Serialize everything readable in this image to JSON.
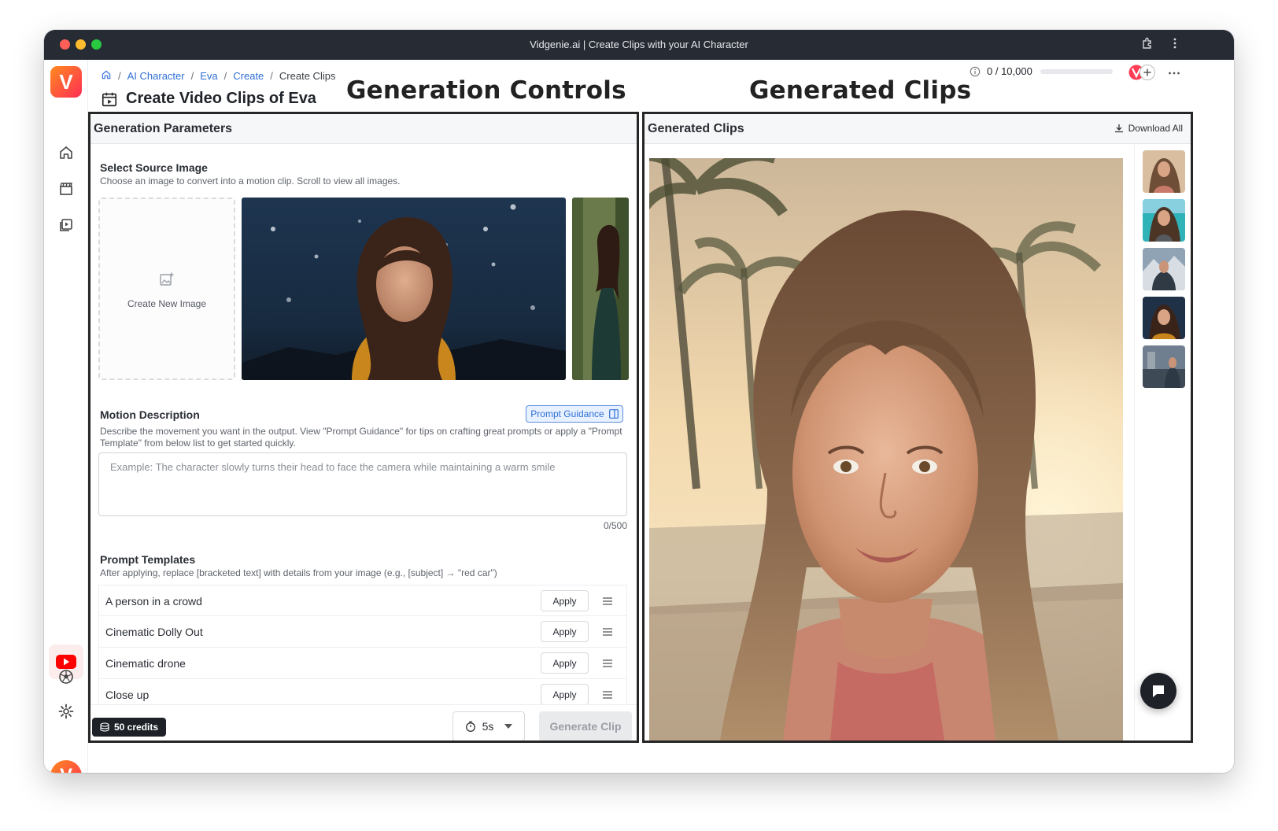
{
  "window": {
    "title": "Vidgenie.ai | Create Clips with your AI Character"
  },
  "sidebar": {
    "logo_letter": "V",
    "avatar_letter": "V",
    "icons": [
      "home-icon",
      "clapperboard-icon",
      "video-library-icon",
      "youtube-icon",
      "soccer-ball-icon",
      "gear-icon"
    ]
  },
  "breadcrumb": {
    "items": [
      "AI Character",
      "Eva",
      "Create"
    ],
    "current": "Create Clips"
  },
  "header": {
    "page_title": "Create Video Clips of Eva",
    "credits_usage": "0 / 10,000"
  },
  "annotations": {
    "left": "Generation Controls",
    "right": "Generated Clips"
  },
  "params_panel": {
    "title": "Generation Parameters",
    "source": {
      "title": "Select Source Image",
      "hint": "Choose an image to convert into a motion clip. Scroll to view all images.",
      "new_image_label": "Create New Image"
    },
    "motion": {
      "title": "Motion Description",
      "guidance_label": "Prompt Guidance",
      "hint": "Describe the movement you want in the output. View \"Prompt Guidance\" for tips on crafting great prompts or apply a \"Prompt Template\" from below list to get started quickly.",
      "placeholder": "Example: The character slowly turns their head to face the camera while maintaining a warm smile",
      "value": "",
      "counter": "0/500"
    },
    "templates": {
      "title": "Prompt Templates",
      "hint": "After applying, replace [bracketed text] with details from your image (e.g., [subject] → \"red car\")",
      "apply_label": "Apply",
      "items": [
        "A person in a crowd",
        "Cinematic Dolly Out",
        "Cinematic drone",
        "Close up"
      ]
    },
    "footer": {
      "credits_label": "50 credits",
      "duration": "5s",
      "generate_label": "Generate Clip"
    }
  },
  "clips_panel": {
    "title": "Generated Clips",
    "download_all": "Download All",
    "thumb_count": 5
  },
  "colors": {
    "accent": "#2f6fd6",
    "brand_gradient_start": "#ff8a1f",
    "brand_gradient_end": "#ff2d55",
    "panel_border": "#262626"
  }
}
